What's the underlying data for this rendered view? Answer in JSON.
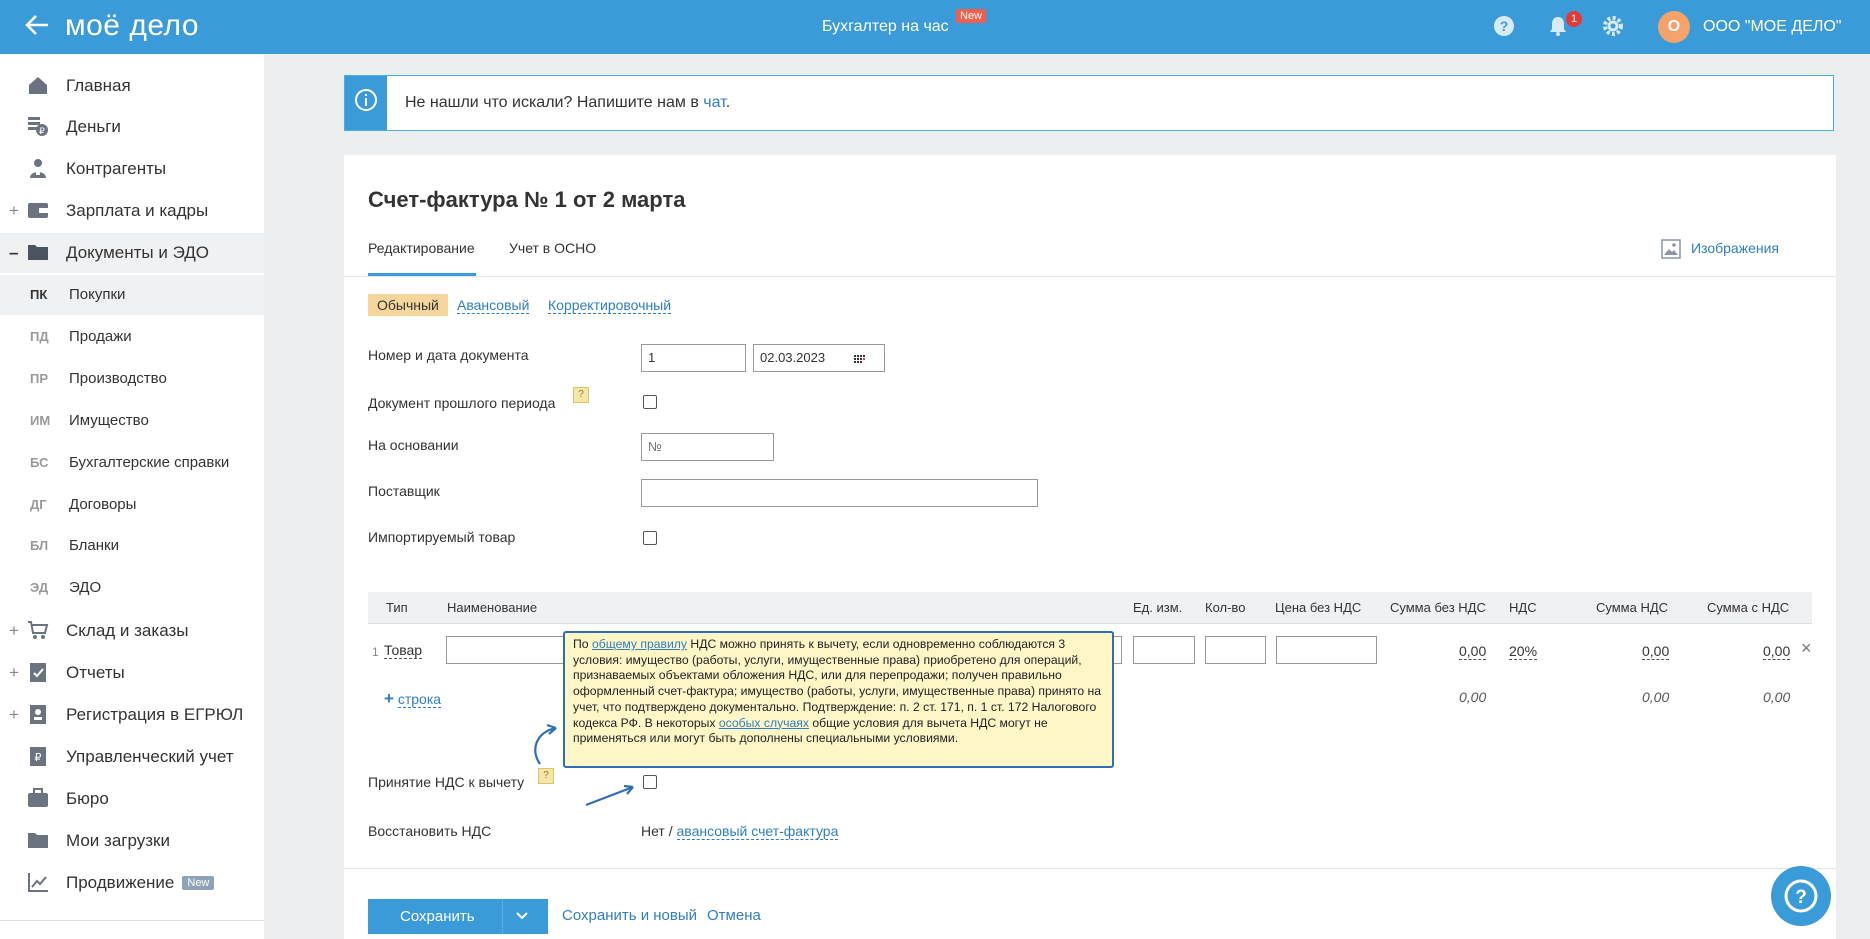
{
  "header": {
    "logo": "моё дело",
    "accountant_link": "Бухгалтер на час",
    "accountant_badge": "New",
    "notifications_count": "1",
    "avatar_letter": "О",
    "org_name": "ООО \"МОЕ ДЕЛО\""
  },
  "sidebar": {
    "items": [
      {
        "label": "Главная",
        "icon": "home-icon"
      },
      {
        "label": "Деньги",
        "icon": "money-icon"
      },
      {
        "label": "Контрагенты",
        "icon": "contractors-icon"
      },
      {
        "label": "Зарплата и кадры",
        "icon": "wallet-icon"
      },
      {
        "label": "Документы и ЭДО",
        "icon": "folder-icon"
      }
    ],
    "sub_items": [
      {
        "abbr": "ПК",
        "label": "Покупки"
      },
      {
        "abbr": "ПД",
        "label": "Продажи"
      },
      {
        "abbr": "ПР",
        "label": "Производство"
      },
      {
        "abbr": "ИМ",
        "label": "Имущество"
      },
      {
        "abbr": "БС",
        "label": "Бухгалтерские справки"
      },
      {
        "abbr": "ДГ",
        "label": "Договоры"
      },
      {
        "abbr": "БЛ",
        "label": "Бланки"
      },
      {
        "abbr": "ЭД",
        "label": "ЭДО"
      }
    ],
    "items_after": [
      {
        "label": "Склад и заказы"
      },
      {
        "label": "Отчеты"
      },
      {
        "label": "Регистрация в ЕГРЮЛ"
      },
      {
        "label": "Управленческий учет"
      },
      {
        "label": "Бюро"
      },
      {
        "label": "Мои загрузки"
      },
      {
        "label": "Продвижение",
        "badge": "New"
      }
    ]
  },
  "info_banner": {
    "text": "Не нашли что искали? Напишите нам в ",
    "link": "чат",
    "suffix": "."
  },
  "document": {
    "title": "Счет-фактура № 1 от 2 марта",
    "tabs": [
      "Редактирование",
      "Учет в ОСНО"
    ],
    "images_link": "Изображения",
    "types": {
      "active": "Обычный",
      "others": [
        "Авансовый",
        "Корректировочный"
      ]
    },
    "fields": {
      "number_date_label": "Номер и дата документа",
      "number_value": "1",
      "date_value": "02.03.2023",
      "past_period_label": "Документ прошлого периода",
      "basis_label": "На основании",
      "basis_placeholder": "№",
      "supplier_label": "Поставщик",
      "imported_label": "Импортируемый товар",
      "vat_deduction_label": "Принятие НДС к вычету",
      "restore_vat_label": "Восстановить НДС",
      "restore_vat_no": "Нет",
      "restore_vat_sep": " / ",
      "restore_vat_link": "авансовый счет-фактура"
    },
    "table": {
      "columns": [
        "Тип",
        "Наименование",
        "Ед. изм.",
        "Кол-во",
        "Цена без НДС",
        "Сумма без НДС",
        "НДС",
        "Сумма НДС",
        "Сумма с НДС"
      ],
      "rows": [
        {
          "index": "1",
          "type": "Товар",
          "sum_without_vat": "0,00",
          "vat": "20%",
          "vat_sum": "0,00",
          "sum_with_vat": "0,00"
        }
      ],
      "add_row": "строка",
      "totals": {
        "sum_without_vat": "0,00",
        "vat_sum": "0,00",
        "sum_with_vat": "0,00"
      }
    },
    "tooltip": {
      "p1": "По ",
      "l1": "общему правилу",
      "p2": " НДС можно принять к вычету, если одновременно соблюдаются 3 условия: имущество (работы, услуги, имущественные права) приобретено для операций, признаваемых объектами обложения НДС, или для перепродажи; получен правильно оформленный счет-фактура; имущество (работы, услуги, имущественные права) принято на учет, что подтверждено документально. Подтверждение: п. 2 ст. 171, п. 1 ст. 172 Налогового кодекса РФ. В некоторых ",
      "l2": "особых случаях",
      "p3": " общие условия для вычета НДС могут не применяться или могут быть дополнены специальными условиями."
    },
    "actions": {
      "save": "Сохранить",
      "save_new": "Сохранить и новый",
      "cancel": "Отмена"
    }
  },
  "colors": {
    "brand": "#3b9ad8",
    "badge_red": "#f25f4c",
    "link": "#2f7ec2",
    "active_type": "#f7d69c",
    "tooltip_bg": "#fff6c8"
  }
}
